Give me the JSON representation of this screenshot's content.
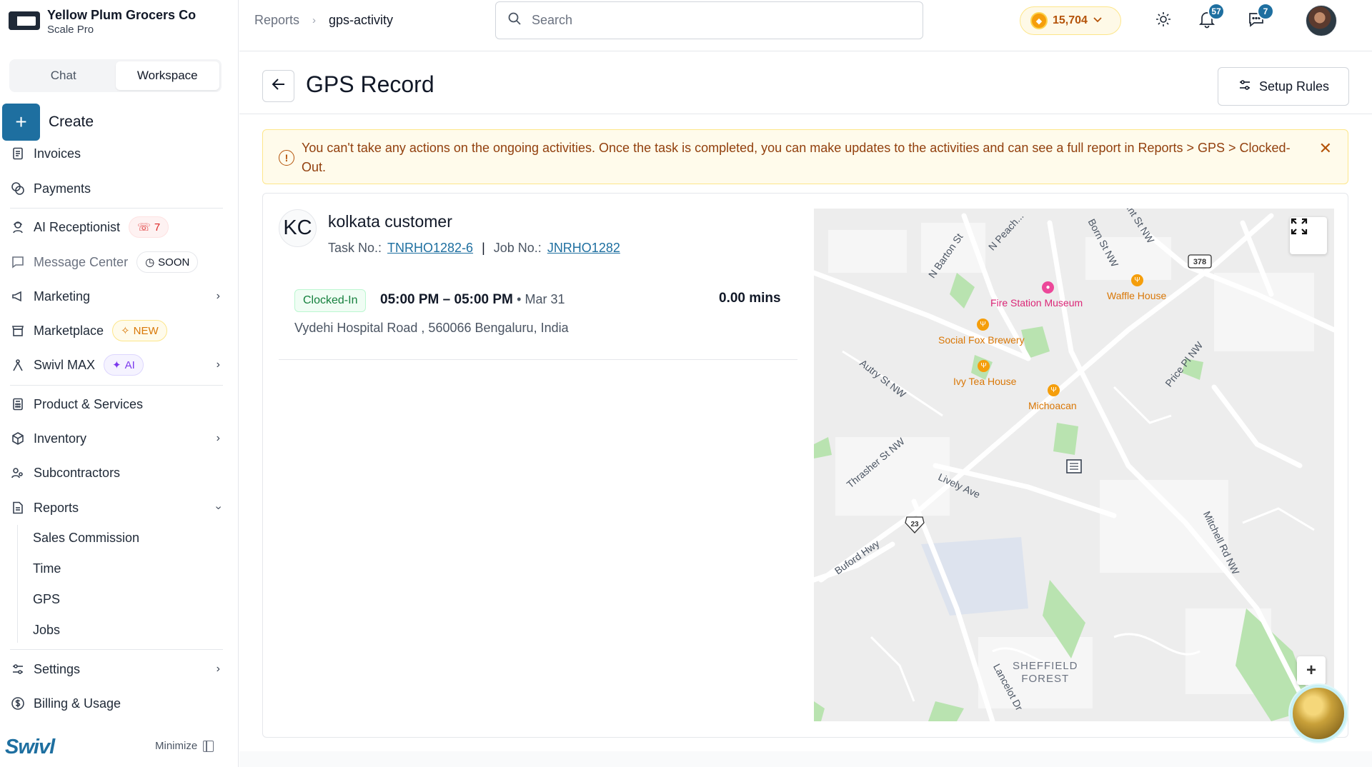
{
  "brand": {
    "name": "Yellow Plum Grocers Co",
    "plan": "Scale Pro"
  },
  "mode_switch": {
    "chat": "Chat",
    "workspace": "Workspace"
  },
  "create_label": "Create",
  "nav": {
    "invoices": "Invoices",
    "payments": "Payments",
    "ai_receptionist": "AI Receptionist",
    "ai_receptionist_count": "7",
    "message_center": "Message Center",
    "message_center_badge": "SOON",
    "marketing": "Marketing",
    "marketplace": "Marketplace",
    "marketplace_badge": "NEW",
    "swivl_max": "Swivl MAX",
    "swivl_max_badge": "AI",
    "products": "Product & Services",
    "inventory": "Inventory",
    "subcontractors": "Subcontractors",
    "reports": "Reports",
    "reports_sub": [
      "Sales Commission",
      "Time",
      "GPS",
      "Jobs"
    ],
    "settings": "Settings",
    "billing": "Billing & Usage"
  },
  "footer": {
    "logo": "Swivl",
    "minimize": "Minimize"
  },
  "topbar": {
    "breadcrumb_root": "Reports",
    "breadcrumb_current": "gps-activity",
    "search_placeholder": "Search",
    "coins": "15,704",
    "notifications_count": "57",
    "messages_count": "7"
  },
  "page": {
    "title": "GPS Record",
    "setup_rules": "Setup Rules"
  },
  "alert": {
    "text": "You can't take any actions on the ongoing activities. Once the task is completed, you can make updates to the activities and can see a full report in Reports > GPS > Clocked-Out."
  },
  "record": {
    "initials": "KC",
    "customer": "kolkata customer",
    "task_label": "Task No.:",
    "task_no": "TNRHO1282-6",
    "separator": "|",
    "job_label": "Job No.:",
    "job_no": "JNRHO1282",
    "status": "Clocked-In",
    "time_range": "05:00 PM – 05:00 PM",
    "date": "• Mar 31",
    "duration": "0.00 mins",
    "address": "Vydehi Hospital Road , 560066 Bengaluru, India"
  },
  "map": {
    "streets": [
      "N Barton St",
      "N Peach...",
      "Born St NW",
      "unt St NW",
      "Autry St NW",
      "Price Pl NW",
      "Thrasher St NW",
      "Lively Ave",
      "Buford Hwy",
      "Mitchell Rd NW",
      "Lancelot Dr"
    ],
    "route_shields": [
      "378",
      "23"
    ],
    "pois": [
      "Fire Station Museum",
      "Waffle House",
      "Social Fox Brewery",
      "Ivy Tea House",
      "Michoacan"
    ],
    "area": "SHEFFIELD\nFOREST",
    "area_line1": "SHEFFIELD",
    "area_line2": "FOREST",
    "colors": {
      "park": "#a8dca0",
      "water": "#c7d2e8",
      "poi_food": "#f59e0b",
      "poi_museum": "#ec4899"
    }
  }
}
